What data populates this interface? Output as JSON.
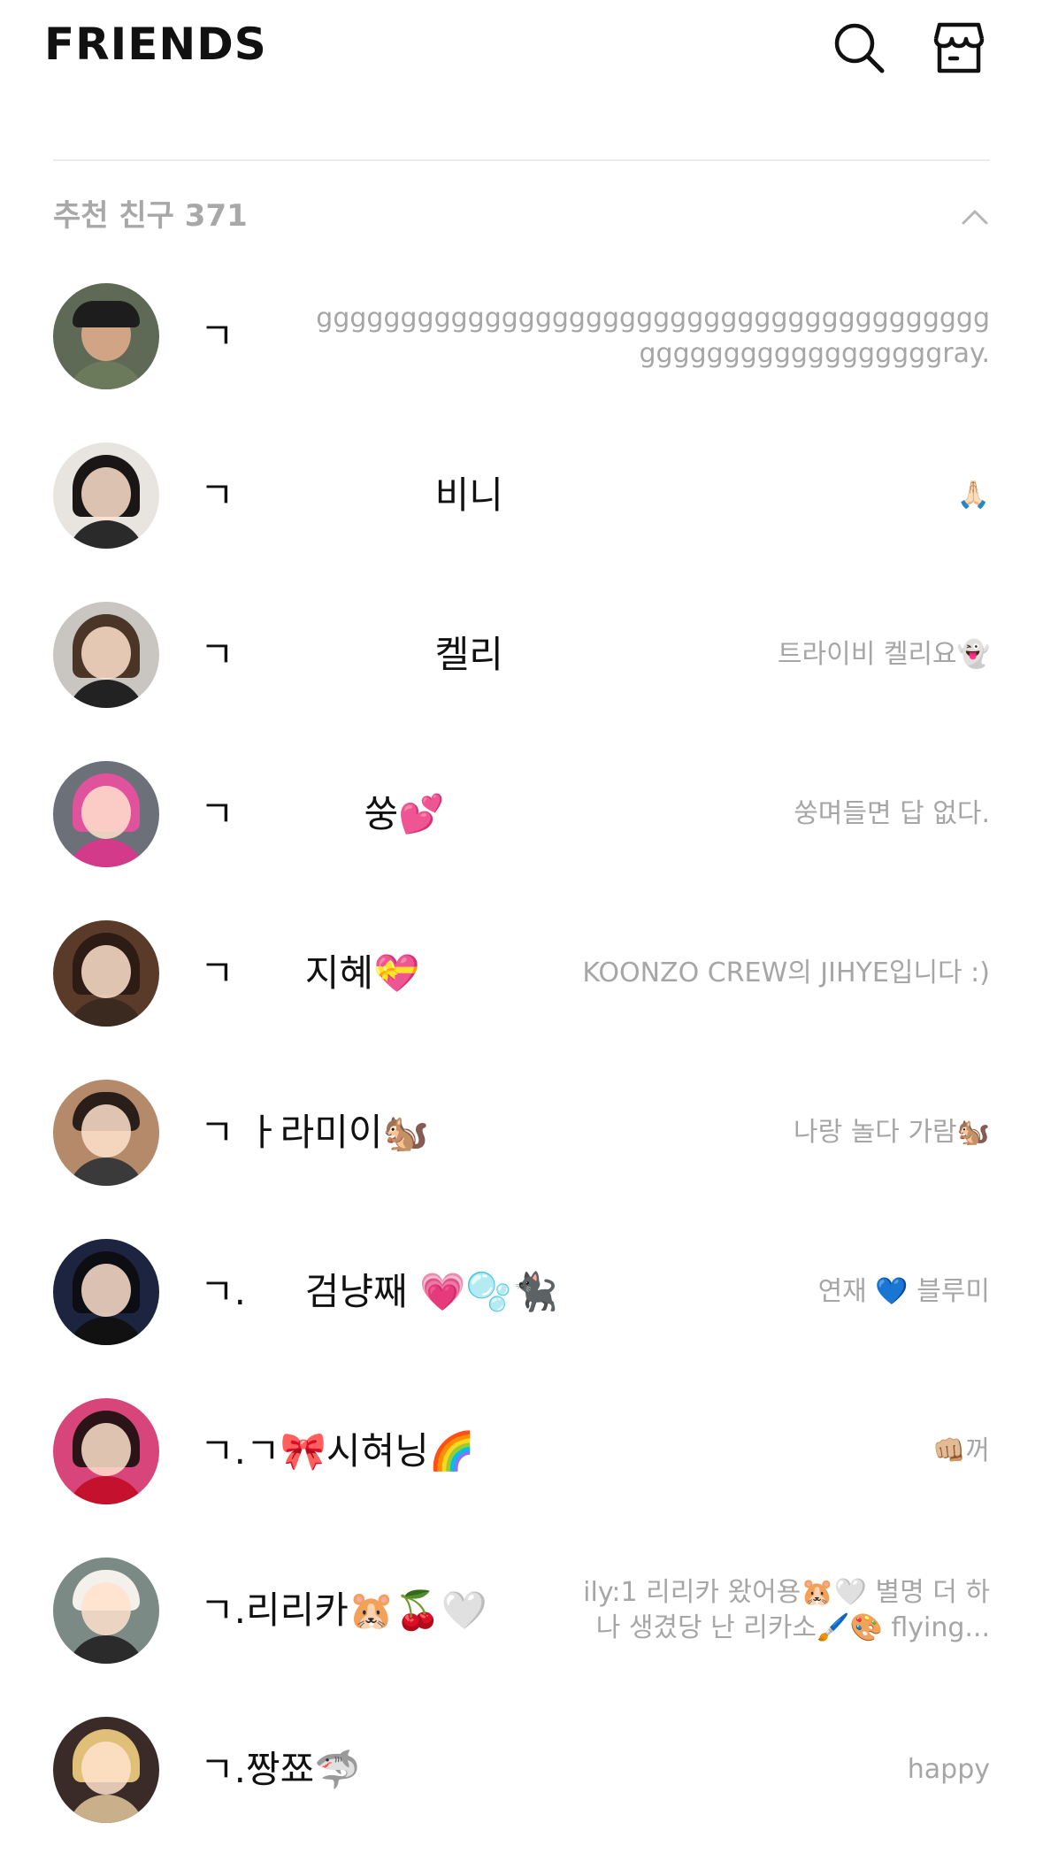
{
  "header": {
    "title": "FRIENDS",
    "search_icon": "search-icon",
    "shop_icon": "shop-icon"
  },
  "section": {
    "label": "추천 친구 371",
    "toggle_icon": "chevron-up-icon"
  },
  "friends": [
    {
      "name": "ㄱ",
      "status": "gggggggggggggggggggggggggggggggggggggggg\nggggggggggggggggggray."
    },
    {
      "name": "ㄱ                 비니",
      "status": "🙏🏻"
    },
    {
      "name": "ㄱ                 켈리",
      "status": "트라이비 켈리요👻"
    },
    {
      "name": "ㄱ           쑹💕",
      "status": "쑹며들면 답 없다."
    },
    {
      "name": "ㄱ      지혜💝",
      "status": "KOONZO CREW의 JIHYE입니다 :)"
    },
    {
      "name": "ㄱ ㅏ라미이🐿️",
      "status": "나랑 놀다 가람🐿️"
    },
    {
      "name": "ㄱ.     검냥째 💗🫧🐈‍⬛",
      "status": "연재 💙 블루미"
    },
    {
      "name": "ㄱ.ㄱ🎀시혀닝🌈",
      "status": "👊🏼꺼"
    },
    {
      "name": "ㄱ.리리카🐹🍒🤍",
      "status": "ily:1 리리카 왔어용🐹🤍 별명 더 하\n나 생겼당 난 리카소🖌️🎨 flying..."
    },
    {
      "name": "ㄱ.짱쬬🦈",
      "status": "happy"
    }
  ],
  "colors": {
    "text_primary": "#111111",
    "text_secondary": "#a6a6a6",
    "section_label": "#a8a8a8",
    "divider": "#ececec"
  }
}
